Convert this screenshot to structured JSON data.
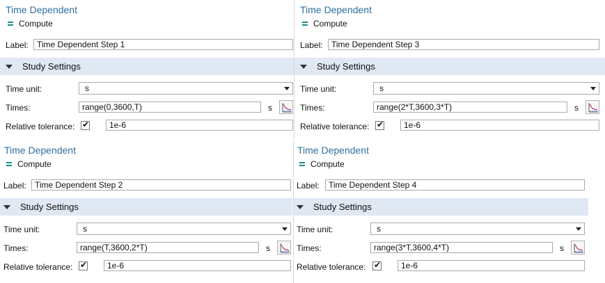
{
  "panels": [
    {
      "title": "Time Dependent",
      "compute_label": "Compute",
      "label_caption": "Label:",
      "label_value": "Time Dependent Step 1",
      "section_title": "Study Settings",
      "time_unit_caption": "Time unit:",
      "time_unit_value": "s",
      "times_caption": "Times:",
      "times_value": "range(0,3600,T)",
      "times_unit": "s",
      "rel_tol_caption": "Relative tolerance:",
      "rel_tol_checked": "✔",
      "rel_tol_value": "1e-6"
    },
    {
      "title": "Time Dependent",
      "compute_label": "Compute",
      "label_caption": "Label:",
      "label_value": "Time Dependent Step 3",
      "section_title": "Study Settings",
      "time_unit_caption": "Time unit:",
      "time_unit_value": "s",
      "times_caption": "Times:",
      "times_value": "range(2*T,3600,3*T)",
      "times_unit": "s",
      "rel_tol_caption": "Relative tolerance:",
      "rel_tol_checked": "✔",
      "rel_tol_value": "1e-6"
    },
    {
      "title": "Time Dependent",
      "compute_label": "Compute",
      "label_caption": "Label:",
      "label_value": "Time Dependent Step 2",
      "section_title": "Study Settings",
      "time_unit_caption": "Time unit:",
      "time_unit_value": "s",
      "times_caption": "Times:",
      "times_value": "range(T,3600,2*T)",
      "times_unit": "s",
      "rel_tol_caption": "Relative tolerance:",
      "rel_tol_checked": "✔",
      "rel_tol_value": "1e-6"
    },
    {
      "title": "Time Dependent",
      "compute_label": "Compute",
      "label_caption": "Label:",
      "label_value": "Time Dependent Step 4",
      "section_title": "Study Settings",
      "time_unit_caption": "Time unit:",
      "time_unit_value": "s",
      "times_caption": "Times:",
      "times_value": "range(3*T,3600,4*T)",
      "times_unit": "s",
      "rel_tol_caption": "Relative tolerance:",
      "rel_tol_checked": "✔",
      "rel_tol_value": "1e-6"
    }
  ],
  "icons": {
    "compute": "compute-icon",
    "section_toggle": "collapse-triangle-icon",
    "dropdown": "chevron-down-icon",
    "range": "range-plot-icon",
    "check": "check-icon"
  },
  "colors": {
    "title": "#2f6f9f",
    "section_bar": "#dfe8f3",
    "compute_icon": "#1a8a8a"
  }
}
